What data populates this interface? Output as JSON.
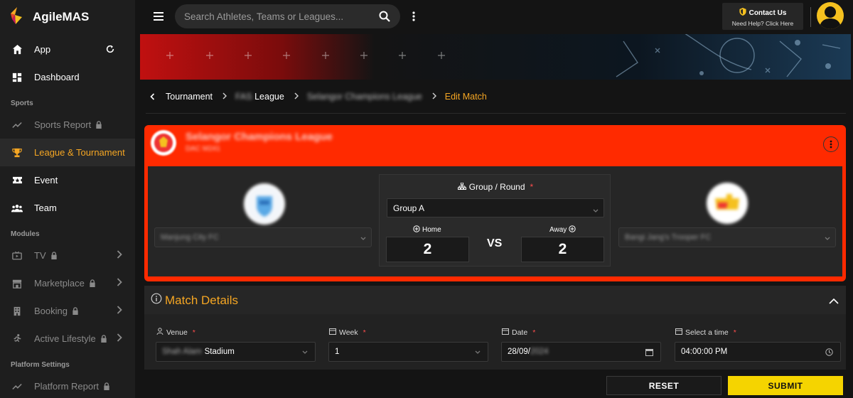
{
  "brand": {
    "name": "AgileMAS"
  },
  "sidebar": {
    "items_top": [
      {
        "label": "App",
        "icon": "home-icon"
      },
      {
        "label": "Dashboard",
        "icon": "dashboard-icon"
      }
    ],
    "sections": [
      {
        "label": "Sports"
      },
      {
        "label": "Modules"
      },
      {
        "label": "Platform Settings"
      }
    ],
    "sports_items": [
      {
        "label": "Sports Report",
        "icon": "trending-icon",
        "locked": true
      },
      {
        "label": "League & Tournament",
        "icon": "trophy-icon",
        "active": true
      },
      {
        "label": "Event",
        "icon": "ticket-icon"
      },
      {
        "label": "Team",
        "icon": "group-icon"
      }
    ],
    "module_items": [
      {
        "label": "TV",
        "icon": "tv-icon",
        "locked": true
      },
      {
        "label": "Marketplace",
        "icon": "store-icon",
        "locked": true
      },
      {
        "label": "Booking",
        "icon": "building-icon",
        "locked": true
      },
      {
        "label": "Active Lifestyle",
        "icon": "run-icon",
        "locked": true
      }
    ],
    "platform_items": [
      {
        "label": "Platform Report",
        "icon": "trending-icon",
        "locked": true
      }
    ]
  },
  "topbar": {
    "search_placeholder": "Search Athletes, Teams or Leagues...",
    "contact_title": "Contact Us",
    "contact_sub": "Need Help? Click Here"
  },
  "breadcrumb": {
    "items": [
      "Tournament",
      "FAS League",
      "Selangor Champions League"
    ],
    "current": "Edit Match"
  },
  "match": {
    "league_name": "Selangor Champions League",
    "league_sub": "DAC M241",
    "home_team": "Manjung City FC",
    "away_team": "Bangi Jang's Trooper FC",
    "round_label": "Group / Round",
    "round_value": "Group A",
    "home_label": "Home",
    "away_label": "Away",
    "home_score": "2",
    "away_score": "2",
    "vs": "VS"
  },
  "details": {
    "title": "Match Details",
    "venue_label": "Venue",
    "venue_blur": "Shah Alam",
    "venue_value": "Stadium",
    "week_label": "Week",
    "week_value": "1",
    "date_label": "Date",
    "date_value": "28/09/",
    "date_blur": "2024",
    "time_label": "Select a time",
    "time_value": "04:00:00 PM",
    "required_mark": "*"
  },
  "actions": {
    "reset": "RESET",
    "submit": "SUBMIT"
  },
  "colors": {
    "accent": "#f5a623",
    "card_red": "#ff2a00",
    "submit": "#f5d400"
  }
}
